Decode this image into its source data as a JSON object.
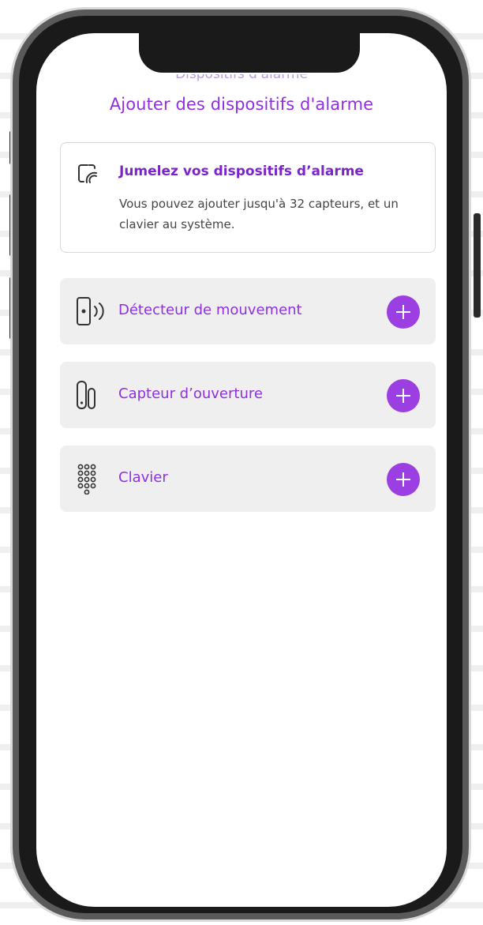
{
  "header": {
    "partial_title": "Dispositifs d'alarme",
    "title": "Ajouter des dispositifs d'alarme"
  },
  "info_card": {
    "icon": "pairing-icon",
    "title": "Jumelez vos dispositifs d’alarme",
    "text": "Vous pouvez ajouter jusqu'à 32 capteurs, et un clavier au système."
  },
  "devices": [
    {
      "label": "Détecteur de mouvement",
      "icon": "motion-detector-icon"
    },
    {
      "label": "Capteur d’ouverture",
      "icon": "door-sensor-icon"
    },
    {
      "label": "Clavier",
      "icon": "keypad-icon"
    }
  ],
  "colors": {
    "accent": "#8f2fe2",
    "button": "#9b3fe3",
    "row_bg": "#efefef"
  }
}
